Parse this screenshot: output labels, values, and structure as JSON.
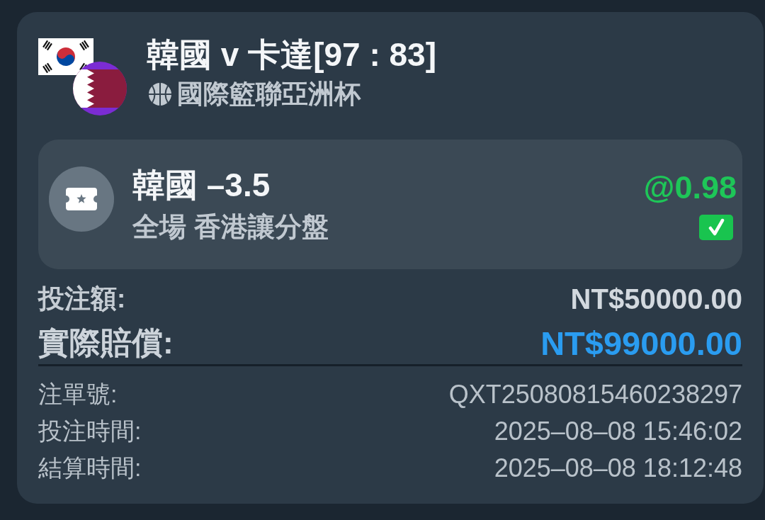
{
  "match": {
    "title": "韓國 v 卡達[97 : 83]",
    "league": "國際籃聯亞洲杯"
  },
  "bet": {
    "selection": "韓國 –3.5",
    "market": "全場 香港讓分盤",
    "odds": "@0.98",
    "won": true
  },
  "amounts": [
    {
      "kind": "stake",
      "label": "投注額:",
      "value": "NT$50000.00"
    },
    {
      "kind": "payout",
      "label": "實際賠償:",
      "value": "NT$99000.00"
    }
  ],
  "details": [
    {
      "label": "注單號:",
      "value": "QXT25080815460238297"
    },
    {
      "label": "投注時間:",
      "value": "2025–08–08 15:46:02"
    },
    {
      "label": "結算時間:",
      "value": "2025–08–08 18:12:48"
    }
  ]
}
